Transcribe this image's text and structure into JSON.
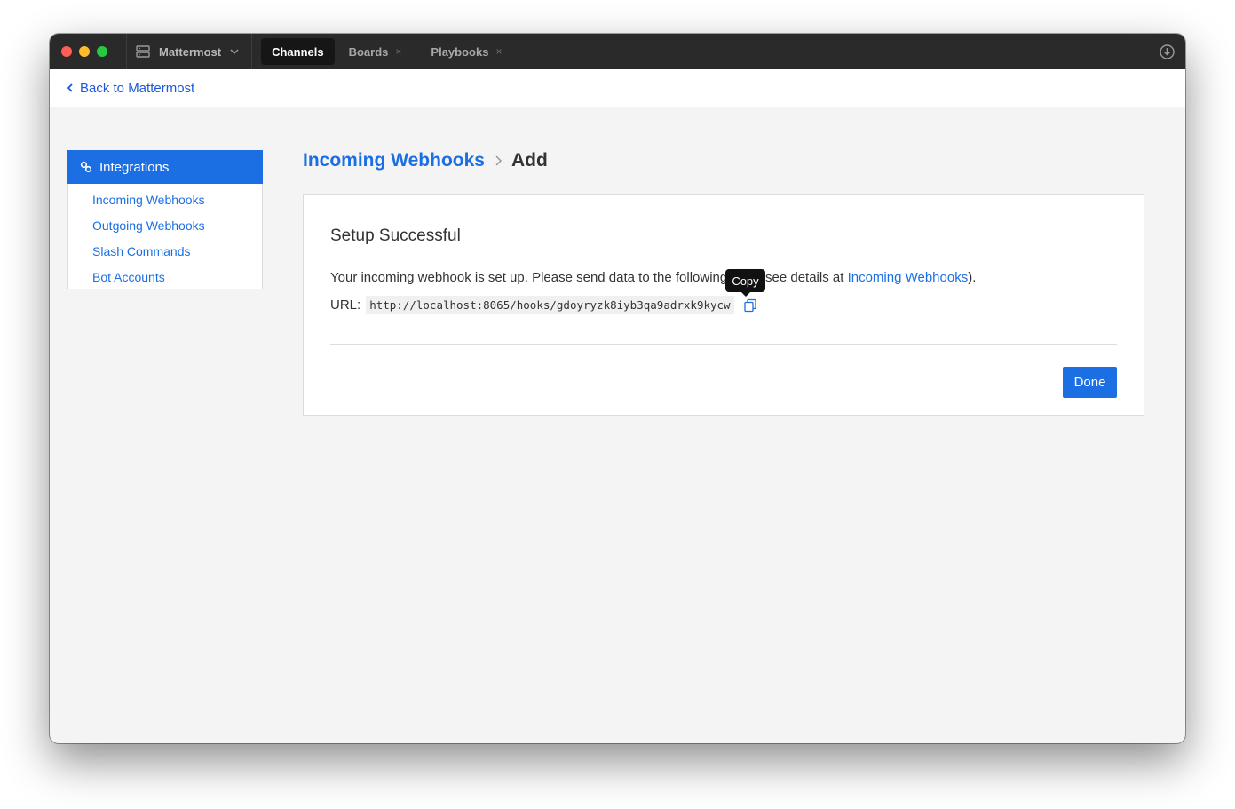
{
  "titlebar": {
    "server_name": "Mattermost",
    "tabs": [
      {
        "label": "Channels",
        "active": true
      },
      {
        "label": "Boards",
        "active": false,
        "close": "×"
      },
      {
        "label": "Playbooks",
        "active": false,
        "close": "×"
      }
    ]
  },
  "backbar": {
    "back_label": "Back to Mattermost"
  },
  "sidebar": {
    "header": "Integrations",
    "items": [
      {
        "label": "Incoming Webhooks"
      },
      {
        "label": "Outgoing Webhooks"
      },
      {
        "label": "Slash Commands"
      },
      {
        "label": "Bot Accounts"
      }
    ]
  },
  "main": {
    "breadcrumb": {
      "parent": "Incoming Webhooks",
      "separator": ">",
      "current": "Add"
    },
    "panel": {
      "title": "Setup Successful",
      "message_before": "Your incoming webhook is set up. Please send data to the following URL (see details at ",
      "message_link": "Incoming Webhooks",
      "message_after": ").",
      "url_label": "URL:",
      "url_value": "http://localhost:8065/hooks/gdoyryzk8iyb3qa9adrxk9kycw",
      "tooltip": "Copy",
      "done_label": "Done"
    }
  },
  "colors": {
    "accent": "#1c6fe3",
    "titlebar": "#2a2a2a"
  },
  "icons": {
    "server": "server-icon",
    "chevron": "chevron-down-icon",
    "download": "download-icon",
    "back": "chevron-left-icon",
    "integrations": "link-icon",
    "copy": "copy-icon"
  }
}
